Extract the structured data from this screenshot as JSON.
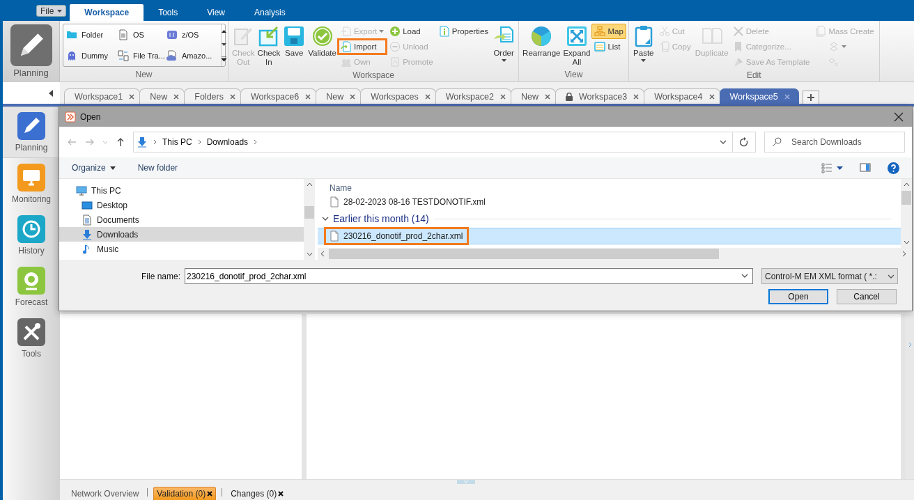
{
  "file_menu": {
    "label": "File"
  },
  "ribbon_tabs": [
    {
      "label": "Workspace",
      "selected": true
    },
    {
      "label": "Tools",
      "selected": false
    },
    {
      "label": "View",
      "selected": false
    },
    {
      "label": "Analysis",
      "selected": false
    }
  ],
  "planning_button": {
    "label": "Planning"
  },
  "ribbon_groups": [
    {
      "label": "New",
      "items": [
        {
          "kind": "gallery",
          "items": [
            {
              "label": "Folder"
            },
            {
              "label": "OS"
            },
            {
              "label": "z/OS"
            },
            {
              "label": "Dummy"
            },
            {
              "label": "File Tra..."
            },
            {
              "label": "Amazo..."
            }
          ]
        }
      ]
    },
    {
      "label": "Workspace",
      "items": [
        {
          "kind": "large",
          "label": "Check Out",
          "disabled": true,
          "dropdown": false
        },
        {
          "kind": "large",
          "label": "Check In",
          "disabled": false,
          "dropdown": false
        },
        {
          "kind": "large",
          "label": "Save",
          "disabled": false,
          "dropdown": false
        },
        {
          "kind": "large",
          "label": "Validate",
          "disabled": false,
          "dropdown": false
        },
        {
          "kind": "stack",
          "items": [
            {
              "label": "Export",
              "disabled": true,
              "dropdown": true,
              "highlighted": false
            },
            {
              "label": "Import",
              "disabled": false,
              "dropdown": false,
              "highlighted": true
            },
            {
              "label": "Own",
              "disabled": true,
              "dropdown": false,
              "highlighted": false
            }
          ]
        },
        {
          "kind": "stack",
          "items": [
            {
              "label": "Load",
              "disabled": false,
              "dropdown": false,
              "highlighted": false
            },
            {
              "label": "Unload",
              "disabled": true,
              "dropdown": false,
              "highlighted": false
            },
            {
              "label": "Promote",
              "disabled": true,
              "dropdown": false,
              "highlighted": false
            }
          ]
        },
        {
          "kind": "stack",
          "items": [
            {
              "label": "Properties",
              "disabled": false,
              "dropdown": false,
              "highlighted": false
            }
          ]
        },
        {
          "kind": "large",
          "label": "Order",
          "disabled": false,
          "dropdown": true
        }
      ]
    },
    {
      "label": "View",
      "items": [
        {
          "kind": "large",
          "label": "Rearrange",
          "disabled": false,
          "dropdown": false
        },
        {
          "kind": "large",
          "label": "Expand All",
          "disabled": false,
          "dropdown": false
        },
        {
          "kind": "stack",
          "items": [
            {
              "label": "Map",
              "disabled": false,
              "dropdown": false,
              "highlighted": false,
              "selected": true
            },
            {
              "label": "List",
              "disabled": false,
              "dropdown": false,
              "highlighted": false,
              "selected": false
            }
          ]
        }
      ]
    },
    {
      "label": "Edit",
      "items": [
        {
          "kind": "large",
          "label": "Paste",
          "disabled": false,
          "dropdown": true
        },
        {
          "kind": "stack",
          "items": [
            {
              "label": "Cut",
              "disabled": true,
              "dropdown": false,
              "highlighted": false
            },
            {
              "label": "Copy",
              "disabled": true,
              "dropdown": false,
              "highlighted": false
            }
          ]
        },
        {
          "kind": "large",
          "label": "Duplicate",
          "disabled": true,
          "dropdown": false
        },
        {
          "kind": "stack",
          "items": [
            {
              "label": "Delete",
              "disabled": true,
              "dropdown": false,
              "highlighted": false
            },
            {
              "label": "Categorize...",
              "disabled": true,
              "dropdown": false,
              "highlighted": false
            },
            {
              "label": "Save As Template",
              "disabled": true,
              "dropdown": false,
              "highlighted": false
            }
          ]
        },
        {
          "kind": "stack",
          "items": [
            {
              "label": "Mass Create",
              "disabled": true,
              "dropdown": false,
              "highlighted": false
            },
            {
              "disabled": true,
              "dropdown": true,
              "highlighted": false
            },
            {
              "disabled": true,
              "dropdown": false,
              "highlighted": false
            }
          ]
        }
      ]
    }
  ],
  "doc_tabs": [
    {
      "label": "Workspace1",
      "selected": false,
      "locked": false
    },
    {
      "label": "New",
      "selected": false,
      "locked": false
    },
    {
      "label": "Folders",
      "selected": false,
      "locked": false
    },
    {
      "label": "Workspace6",
      "selected": false,
      "locked": false
    },
    {
      "label": "New",
      "selected": false,
      "locked": false
    },
    {
      "label": "Workspaces",
      "selected": false,
      "locked": false
    },
    {
      "label": "Workspace2",
      "selected": false,
      "locked": false
    },
    {
      "label": "New",
      "selected": false,
      "locked": false
    },
    {
      "label": "Workspace3",
      "selected": false,
      "locked": true
    },
    {
      "label": "Workspace4",
      "selected": false,
      "locked": false
    },
    {
      "label": "Workspace5",
      "selected": true,
      "locked": false
    }
  ],
  "sidebar": [
    {
      "label": "Planning",
      "selected": true
    },
    {
      "label": "Monitoring",
      "selected": false
    },
    {
      "label": "History",
      "selected": false
    },
    {
      "label": "Forecast",
      "selected": false
    },
    {
      "label": "Tools",
      "selected": false
    }
  ],
  "dialog": {
    "title": "Open",
    "breadcrumb": [
      "This PC",
      "Downloads"
    ],
    "search": {
      "placeholder": "Search Downloads"
    },
    "toolbar": {
      "organize": "Organize",
      "new_folder": "New folder"
    },
    "nav": [
      {
        "label": "This PC",
        "selected": false,
        "children": [
          {
            "label": "Desktop",
            "selected": false
          },
          {
            "label": "Documents",
            "selected": false
          },
          {
            "label": "Downloads",
            "selected": true
          },
          {
            "label": "Music",
            "selected": false
          }
        ]
      }
    ],
    "file_list": {
      "column": "Name",
      "items": [
        {
          "kind": "file",
          "label": "28-02-2023 08-16 TESTDONOTIF.xml",
          "selected": false,
          "highlighted": false
        },
        {
          "kind": "group",
          "label": "Earlier this month (14)",
          "expanded": true
        },
        {
          "kind": "file",
          "label": "230216_donotif_prod_2char.xml",
          "selected": true,
          "highlighted": true
        }
      ]
    },
    "file_name": {
      "label": "File name:",
      "value": "230216_donotif_prod_2char.xml"
    },
    "file_type": {
      "value": "Control-M EM XML format ( *.:"
    },
    "buttons": [
      {
        "label": "Open",
        "default": true
      },
      {
        "label": "Cancel",
        "default": false
      }
    ]
  },
  "bottom_tabs": [
    {
      "label": "Network Overview",
      "selected": false,
      "closable": false
    },
    {
      "label": "Validation (0)",
      "selected": true,
      "closable": true
    },
    {
      "label": "Changes (0)",
      "selected": false,
      "closable": true
    }
  ]
}
